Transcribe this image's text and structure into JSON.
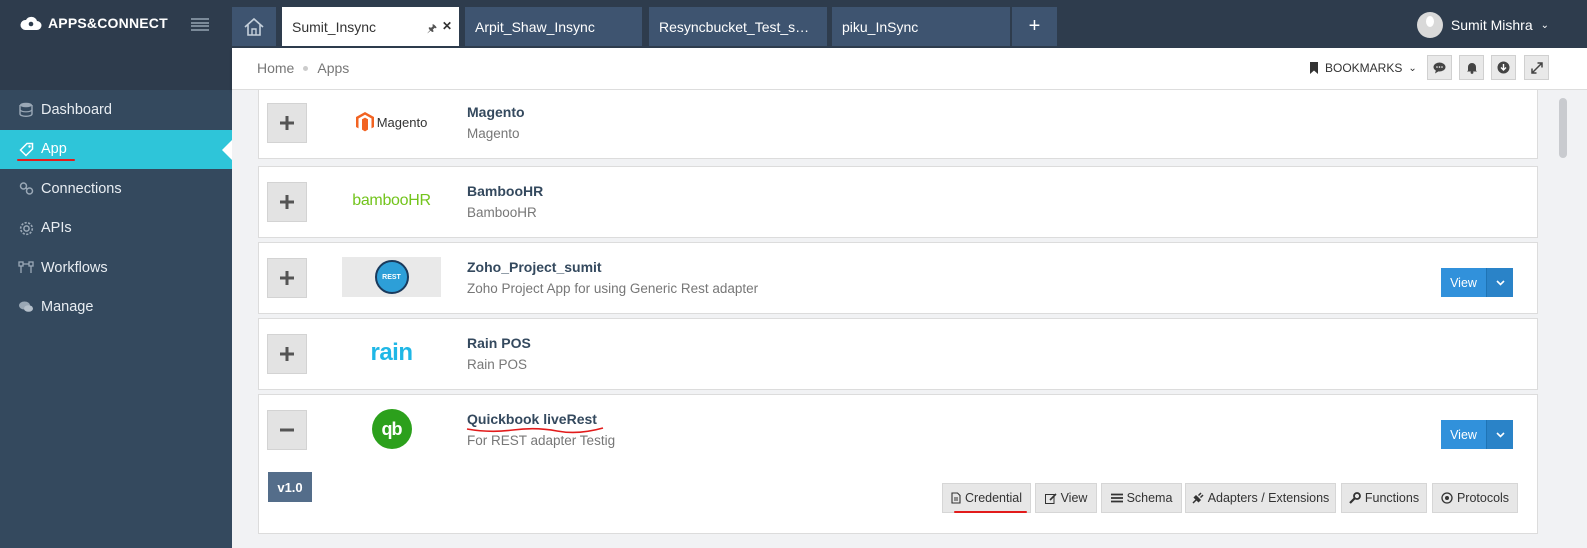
{
  "brand": {
    "name": "APPS&CONNECT"
  },
  "sidebar": {
    "items": [
      {
        "label": "Dashboard",
        "icon": "database-icon"
      },
      {
        "label": "App",
        "icon": "tag-icon",
        "active": true
      },
      {
        "label": "Connections",
        "icon": "link-icon"
      },
      {
        "label": "APIs",
        "icon": "gear-icon"
      },
      {
        "label": "Workflows",
        "icon": "workflow-icon"
      },
      {
        "label": "Manage",
        "icon": "chat-icon"
      }
    ]
  },
  "tabs": [
    {
      "label": "Sumit_Insync",
      "active": true
    },
    {
      "label": "Arpit_Shaw_Insync"
    },
    {
      "label": "Resyncbucket_Test_s…"
    },
    {
      "label": "piku_InSync"
    }
  ],
  "user": {
    "name": "Sumit Mishra"
  },
  "breadcrumb": {
    "home": "Home",
    "current": "Apps"
  },
  "header": {
    "bookmarks_label": "BOOKMARKS"
  },
  "apps": [
    {
      "name": "Magento",
      "description": "Magento",
      "logo": "Magento",
      "expanded": false,
      "has_view": false
    },
    {
      "name": "BambooHR",
      "description": "BambooHR",
      "logo": "bambooHR",
      "expanded": false,
      "has_view": false
    },
    {
      "name": "Zoho_Project_sumit",
      "description": "Zoho Project App for using Generic Rest adapter",
      "logo": "REST",
      "expanded": false,
      "has_view": true
    },
    {
      "name": "Rain POS",
      "description": "Rain POS",
      "logo": "rain",
      "expanded": false,
      "has_view": false
    },
    {
      "name": "Quickbook liveRest",
      "description": "For REST adapter Testig",
      "logo": "qb",
      "expanded": true,
      "has_view": true
    }
  ],
  "view_label": "View",
  "expanded_panel": {
    "version": "v1.0",
    "buttons": [
      {
        "label": "Credential",
        "icon": "file-icon"
      },
      {
        "label": "View",
        "icon": "edit-icon"
      },
      {
        "label": "Schema",
        "icon": "list-icon"
      },
      {
        "label": "Adapters / Extensions",
        "icon": "plug-icon"
      },
      {
        "label": "Functions",
        "icon": "wrench-icon"
      },
      {
        "label": "Protocols",
        "icon": "target-icon"
      }
    ]
  },
  "colors": {
    "sidebar_bg": "#34495e",
    "active_nav": "#2ec5d9",
    "primary_button": "#3191db",
    "annotation_red": "#e21b1b"
  }
}
